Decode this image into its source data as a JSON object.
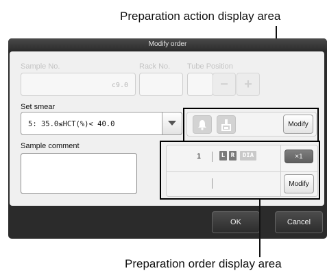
{
  "callouts": {
    "top": "Preparation action display area",
    "bottom": "Preparation order display area"
  },
  "dialog": {
    "title": "Modify order",
    "sample_no_label": "Sample No.",
    "sample_no_value": "c9.0",
    "rack_no_label": "Rack No.",
    "tube_position_label": "Tube Position",
    "minus_label": "−",
    "plus_label": "+",
    "set_smear_label": "Set smear",
    "set_smear_value": "5: 35.0≤HCT(%)< 40.0",
    "sample_comment_label": "Sample comment",
    "action_modify_label": "Modify",
    "order": {
      "count": "1",
      "tag_l": "L",
      "tag_r": "R",
      "tag_dia": "DIA",
      "multiplier": "×1",
      "modify_label": "Modify"
    },
    "ok_label": "OK",
    "cancel_label": "Cancel"
  },
  "icons": [
    "bell-icon",
    "slide-smear-icon",
    "dropdown-arrow-icon"
  ],
  "colors": {
    "tag_active": "#7a7a7a",
    "tag_inactive": "#c9c9c9",
    "dialog_frame": "#2b2b2b"
  }
}
